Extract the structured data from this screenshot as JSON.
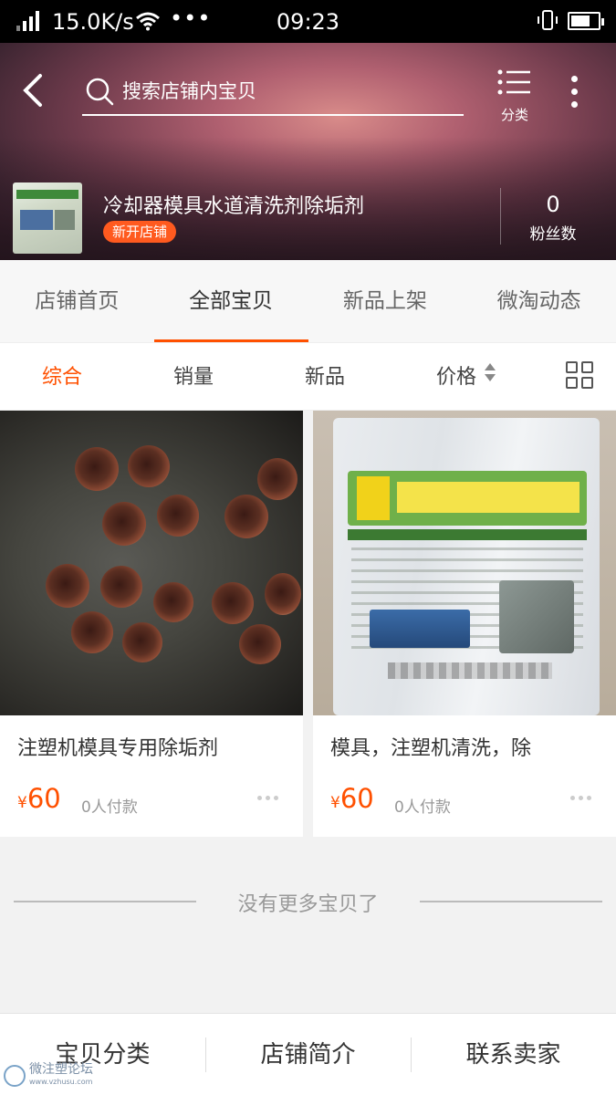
{
  "status_bar": {
    "speed": "15.0K/s",
    "dots": "•••",
    "time": "09:23"
  },
  "nav": {
    "search_placeholder": "搜索店铺内宝贝",
    "category_label": "分类"
  },
  "shop": {
    "name": "冷却器模具水道清洗剂除垢剂",
    "badge": "新开店铺",
    "fans_count": "0",
    "fans_label": "粉丝数"
  },
  "tabs": [
    {
      "label": "店铺首页",
      "active": false
    },
    {
      "label": "全部宝贝",
      "active": true
    },
    {
      "label": "新品上架",
      "active": false
    },
    {
      "label": "微淘动态",
      "active": false
    }
  ],
  "sort": [
    {
      "label": "综合",
      "active": true
    },
    {
      "label": "销量",
      "active": false
    },
    {
      "label": "新品",
      "active": false
    },
    {
      "label": "价格",
      "active": false
    }
  ],
  "products": [
    {
      "title": "注塑机模具专用除垢剂",
      "currency": "¥",
      "price": "60",
      "sold": "0人付款"
    },
    {
      "title": "模具，注塑机清洗，除",
      "currency": "¥",
      "price": "60",
      "sold": "0人付款"
    }
  ],
  "footer_note": "没有更多宝贝了",
  "bottom_bar": {
    "categories": "宝贝分类",
    "intro": "店铺简介",
    "contact": "联系卖家"
  },
  "watermark": {
    "text": "微注塑论坛",
    "url": "www.vzhusu.com"
  },
  "colors": {
    "accent": "#ff5000",
    "badge": "#ff5a1f"
  }
}
